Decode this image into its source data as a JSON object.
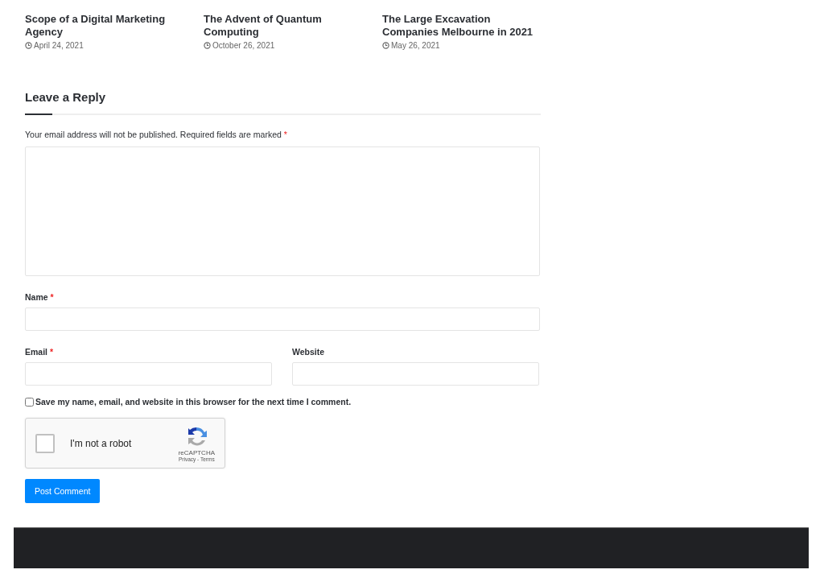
{
  "related_posts": [
    {
      "title": "Scope of a Digital Marketing Agency",
      "date": "April 24, 2021"
    },
    {
      "title": "The Advent of Quantum Computing",
      "date": "October 26, 2021"
    },
    {
      "title": "The Large Excavation Companies Melbourne in 2021",
      "date": "May 26, 2021"
    }
  ],
  "reply": {
    "heading": "Leave a Reply",
    "notice": "Your email address will not be published. Required fields are marked",
    "notice_mark": "*",
    "fields": [
      {
        "kind": "textarea"
      },
      {
        "kind": "text",
        "label": "Name",
        "required": true
      },
      {
        "kind": "half",
        "label": "Email",
        "required": true
      },
      {
        "kind": "half",
        "label": "Website",
        "required": false
      }
    ],
    "save_info": {
      "label": "Save my name, email, and website in this browser for the next time I comment.",
      "checked": false
    },
    "captcha": {
      "label": "I'm not a robot",
      "checked": false,
      "brand": "reCAPTCHA",
      "links": "Privacy - Terms"
    },
    "submit": "Post Comment"
  }
}
